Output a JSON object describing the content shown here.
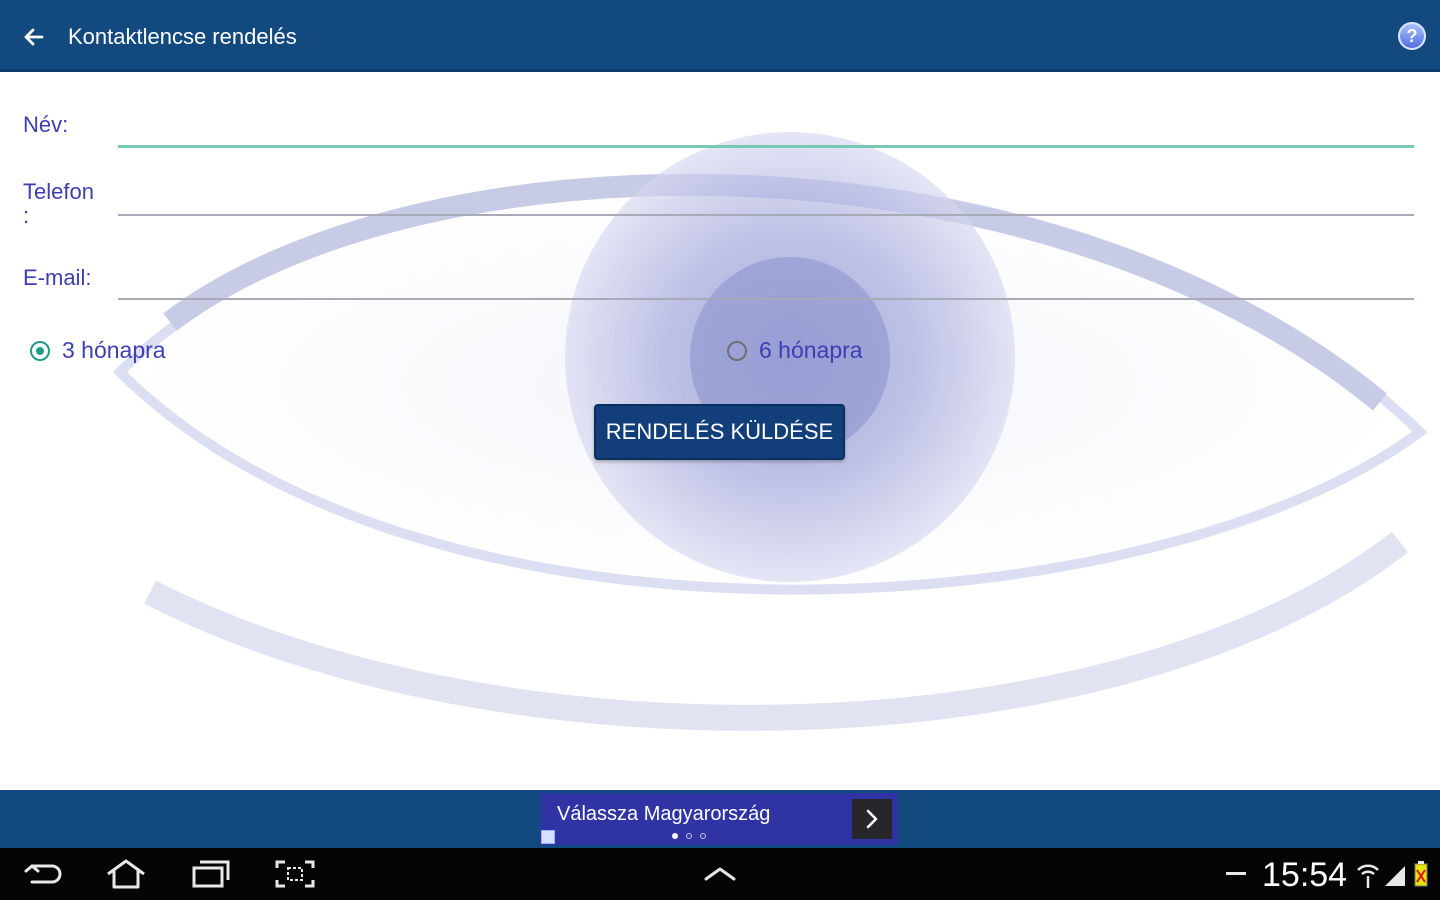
{
  "app_bar": {
    "title": "Kontaktlencse rendelés",
    "back_icon": "arrow-left-icon",
    "help_icon": "help-icon",
    "help_symbol": "?"
  },
  "form": {
    "name_label": "Név:",
    "phone_label": "Telefon\n:",
    "email_label": "E-mail:",
    "name_value": "",
    "phone_value": "",
    "email_value": ""
  },
  "plan": {
    "options": [
      "3 hónapra",
      "6 hónapra"
    ],
    "selected": "3 hónapra"
  },
  "submit_label": "RENDELÉS KÜLDÉSE",
  "ad": {
    "text": "Válassza Magyarország",
    "arrow_icon": "chevron-right-icon",
    "dots": 3,
    "active_dot": 1
  },
  "system_bar": {
    "time": "15:54",
    "icons": [
      "back-icon",
      "home-icon",
      "recent-apps-icon",
      "screenshot-icon",
      "chevron-up-icon",
      "wifi-icon",
      "signal-icon",
      "battery-icon"
    ]
  },
  "colors": {
    "app_bar": "#124a7f",
    "accent": "#1f9e84",
    "text": "#3d3fb1",
    "button": "#123f7a",
    "ad_banner": "#2f33a3"
  }
}
